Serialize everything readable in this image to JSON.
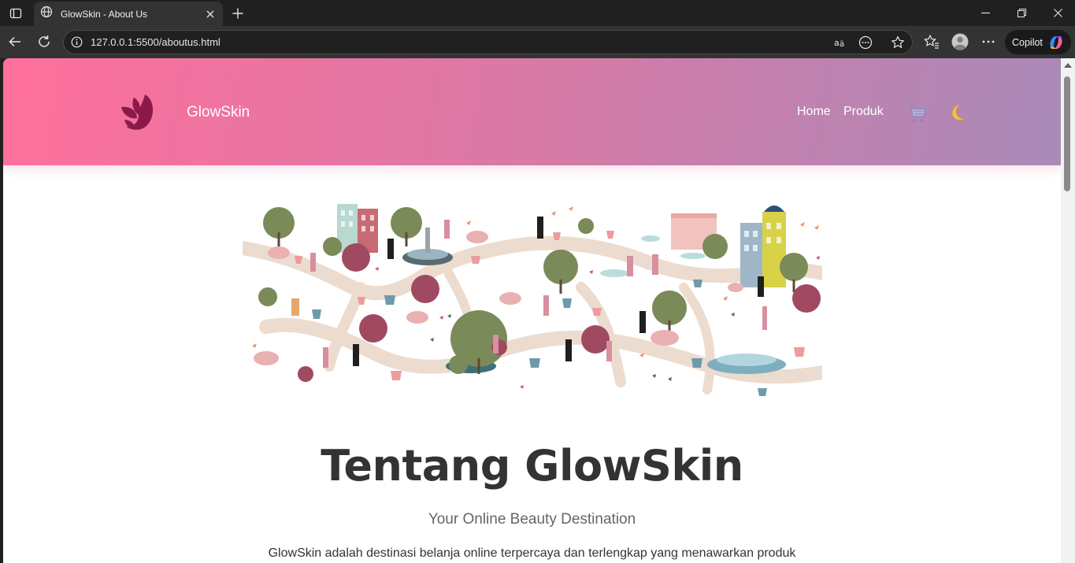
{
  "browser": {
    "tab_title": "GlowSkin - About Us",
    "url": "127.0.0.1:5500/aboutus.html",
    "copilot_label": "Copilot"
  },
  "site": {
    "brand": "GlowSkin",
    "nav": [
      {
        "label": "Home"
      },
      {
        "label": "Produk"
      }
    ],
    "accent_start": "#ff6f9c",
    "accent_end": "#a98ab9",
    "logo_color": "#8b1a4a"
  },
  "main": {
    "title": "Tentang GlowSkin",
    "subtitle": "Your Online Beauty Destination",
    "intro": "GlowSkin adalah destinasi belanja online terpercaya dan terlengkap yang menawarkan produk"
  }
}
